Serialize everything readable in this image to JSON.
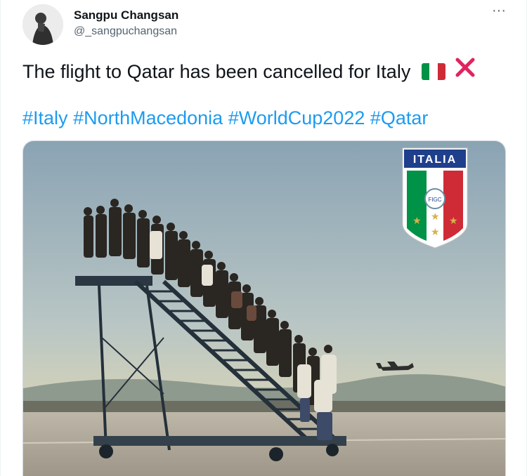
{
  "tweet": {
    "author_name": "Sangpu Changsan",
    "author_handle": "@_sangpuchangsan",
    "more_label": "···",
    "text": "The flight to Qatar has been cancelled for Italy",
    "hashtags": [
      "#Italy",
      "#NorthMacedonia",
      "#WorldCup2022",
      "#Qatar"
    ]
  },
  "media": {
    "badge_text": "ITALIA",
    "badge_inner_text": "FIGC"
  },
  "colors": {
    "link": "#1d9bf0",
    "secondary_text": "#536471",
    "primary_text": "#0f1419",
    "flag_green": "#009246",
    "flag_white": "#ffffff",
    "flag_red": "#ce2b37",
    "cross_red": "#e0245e"
  },
  "icons": {
    "flag": "italy-flag-icon",
    "cross": "cross-mark-icon",
    "more": "more-options-icon"
  }
}
